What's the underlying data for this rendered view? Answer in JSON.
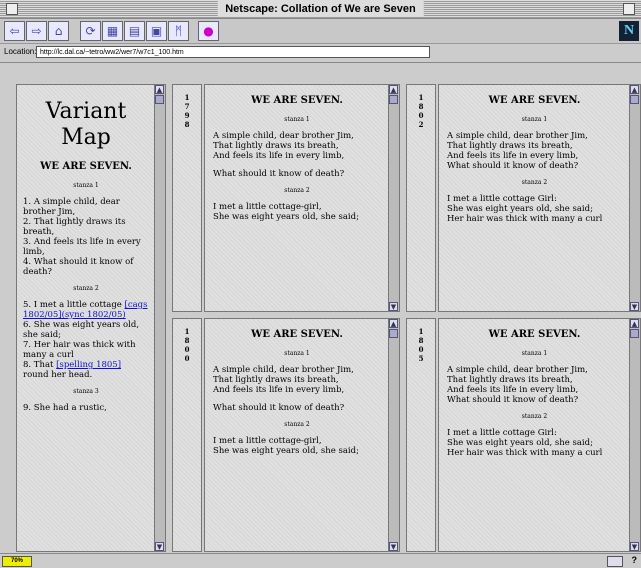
{
  "window": {
    "title": "Netscape: Collation of We are Seven"
  },
  "toolbar": {
    "buttons": [
      {
        "name": "back-button",
        "glyph": "⇦"
      },
      {
        "name": "forward-button",
        "glyph": "⇨"
      },
      {
        "name": "home-button",
        "glyph": "⌂"
      },
      {
        "name": "reload-button",
        "glyph": "⟳"
      },
      {
        "name": "images-button",
        "glyph": "▦"
      },
      {
        "name": "open-button",
        "glyph": "▤"
      },
      {
        "name": "print-button",
        "glyph": "▣"
      },
      {
        "name": "find-button",
        "glyph": "ᛗ"
      },
      {
        "name": "stop-button",
        "glyph": "●"
      }
    ],
    "logo": "N"
  },
  "location": {
    "label": "Location:",
    "url": "http://lc.dal.ca/~tetro/ww2/wer7/w7c1_100.htm"
  },
  "variant_map": {
    "title_line1": "Variant",
    "title_line2": "Map",
    "heading": "WE ARE SEVEN.",
    "stanza1": "stanza 1",
    "items1": [
      {
        "num": "1.",
        "text": "A simple child, dear brother Jim,"
      },
      {
        "num": "2.",
        "text": "That lightly draws its breath,"
      },
      {
        "num": "3.",
        "text": "And feels its life in every limb,"
      },
      {
        "num": "4.",
        "text": "What should it know of death?"
      }
    ],
    "stanza2": "stanza 2",
    "item5_pre": "5. I met a little cottage ",
    "item5_link": "[cags 1802/05](sync 1802/05)",
    "item6": "6. She was eight years old, she said;",
    "item7": "7. Her hair was thick with many a curl",
    "item8_pre": "8. That ",
    "item8_link": "[spelling 1805]",
    "item8_post": " round her head.",
    "stanza3": "stanza 3",
    "item9": "9. She had a rustic,"
  },
  "frames": [
    {
      "year": [
        "1",
        "7",
        "9",
        "8"
      ],
      "heading": "WE ARE SEVEN.",
      "stanza1": "stanza 1",
      "s1": [
        "A simple child, dear brother Jim,",
        "That lightly draws its breath,",
        "And feels its life in every limb,"
      ],
      "s1b": [
        "What should it know of death?"
      ],
      "stanza2": "stanza 2",
      "s2": [
        "I met a little cottage-girl,",
        "She was eight years old, she said;"
      ]
    },
    {
      "year": [
        "1",
        "8",
        "0",
        "2"
      ],
      "heading": "WE ARE SEVEN.",
      "stanza1": "stanza 1",
      "s1": [
        "A simple child, dear brother Jim,",
        "That lightly draws its breath,",
        "And feels its life in every limb,",
        "What should it know of death?"
      ],
      "s1b": [],
      "stanza2": "stanza 2",
      "s2": [
        "I met a little cottage Girl:",
        "She was eight years old, she said;",
        "Her hair was thick with many a curl"
      ]
    },
    {
      "year": [
        "1",
        "8",
        "0",
        "0"
      ],
      "heading": "WE ARE SEVEN.",
      "stanza1": "stanza 1",
      "s1": [
        "A simple child, dear brother Jim,",
        "That lightly draws its breath,",
        "And feels its life in every limb,"
      ],
      "s1b": [
        "What should it know of death?"
      ],
      "stanza2": "stanza 2",
      "s2": [
        "I met a little cottage-girl,",
        "She was eight years old, she said;"
      ]
    },
    {
      "year": [
        "1",
        "8",
        "0",
        "5"
      ],
      "heading": "WE ARE SEVEN.",
      "stanza1": "stanza 1",
      "s1": [
        "A simple child, dear brother Jim,",
        "That lightly draws its breath,",
        "And feels its life in every limb,",
        "What should it know of death?"
      ],
      "s1b": [],
      "stanza2": "stanza 2",
      "s2": [
        "I met a little cottage Girl:",
        "She was eight years old, she said;",
        "Her hair was thick with many a curl"
      ]
    }
  ],
  "status": {
    "progress": "70%"
  }
}
